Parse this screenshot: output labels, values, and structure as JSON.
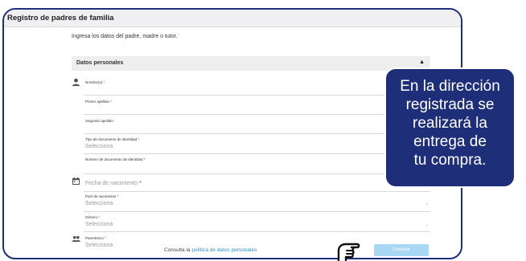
{
  "modal": {
    "title": "Registro de padres de familia",
    "intro": "Ingresa los datos del padre, madre o tutor."
  },
  "section": {
    "title": "Datos personales",
    "caret": "▲"
  },
  "fields": {
    "nombres": {
      "label": "Nombre(s)",
      "req": "*"
    },
    "primer_apellido": {
      "label": "Primer apellido",
      "req": "*"
    },
    "segundo_apellido": {
      "label": "Segundo apellido"
    },
    "tipo_documento": {
      "label": "Tipo de documento de identidad",
      "req": "*",
      "value": "Selecciona"
    },
    "numero_documento": {
      "label": "Número de documento de identidad",
      "req": "*"
    },
    "fecha_nacimiento": {
      "label": "Fecha de nacimiento",
      "req": "*"
    },
    "pais_nacimiento": {
      "label": "País de nacimiento",
      "req": "*",
      "value": "Selecciona"
    },
    "genero": {
      "label": "Género",
      "req": "*",
      "value": "Selecciona"
    },
    "parentesco": {
      "label": "Parentesco",
      "req": "*",
      "value": "Selecciona"
    }
  },
  "footer": {
    "consult_text": "Consulta la",
    "policy_link": "política de datos personales",
    "continue_label": "Continuar"
  },
  "overlay": {
    "lines": [
      "En la dirección",
      "registrada se",
      "realizará la",
      "entrega de",
      "tu compra."
    ]
  },
  "icons": {
    "person": "person-icon",
    "calendar": "calendar-icon",
    "group": "group-icon",
    "hand": "pointing-hand-icon"
  },
  "colors": {
    "brand_navy": "#1f2e78",
    "link": "#2e8fd8",
    "button": "#a8d8f4",
    "required": "#d33333"
  }
}
